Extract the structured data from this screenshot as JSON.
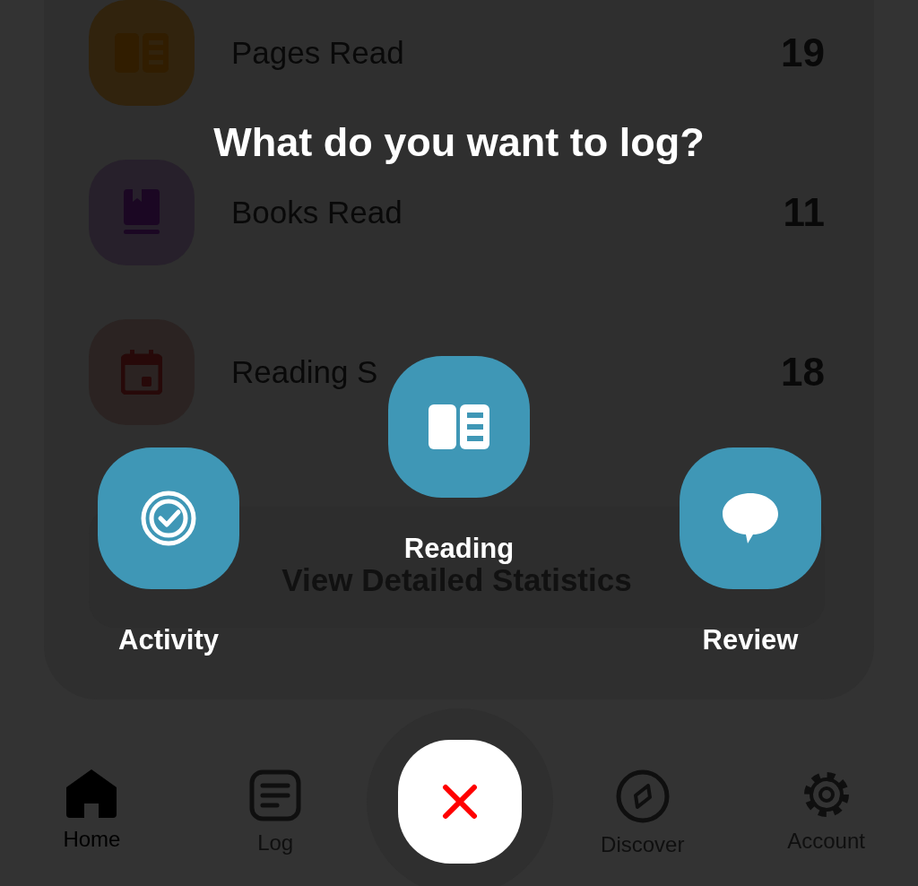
{
  "stats": [
    {
      "kind": "pages",
      "label": "Pages Read",
      "value": "19",
      "color": "#3a2a10"
    },
    {
      "kind": "book",
      "label": "Books Read",
      "value": "11",
      "color": "#2e2633"
    },
    {
      "kind": "calendar",
      "label": "Reading S",
      "value": "18",
      "color": "#332a28"
    }
  ],
  "details_button": "View Detailed Statistics",
  "overlay": {
    "title": "What do you want to log?",
    "actions": [
      {
        "kind": "activity",
        "label": "Activity"
      },
      {
        "kind": "reading",
        "label": "Reading"
      },
      {
        "kind": "review",
        "label": "Review"
      }
    ]
  },
  "tabs": [
    {
      "kind": "home",
      "label": "Home",
      "selected": true
    },
    {
      "kind": "log",
      "label": "Log",
      "selected": false
    },
    {
      "kind": "discover",
      "label": "Discover",
      "selected": false
    },
    {
      "kind": "account",
      "label": "Account",
      "selected": false
    }
  ]
}
